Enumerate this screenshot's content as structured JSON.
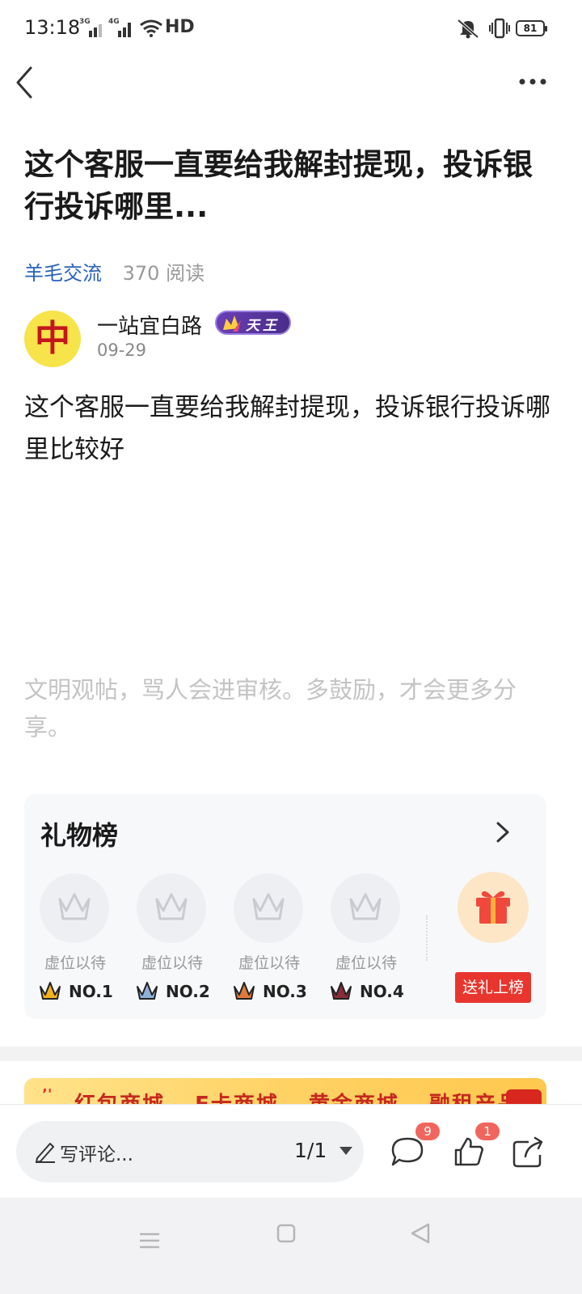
{
  "status_bar": {
    "time": "13:18",
    "signal_1_label": "3G",
    "signal_2_label": "4G",
    "network_label": "HD",
    "battery_level": "81",
    "icons": [
      "signal-icon",
      "wifi-icon",
      "mute-icon",
      "vibrate-icon",
      "battery-icon"
    ]
  },
  "nav": {
    "back_icon": "chevron-left-icon",
    "more_icon": "more-dots-icon"
  },
  "post": {
    "title": "这个客服一直要给我解封提现，投诉银行投诉哪里...",
    "category": "羊毛交流",
    "reads": "370 阅读",
    "author": {
      "name": "一站宜白路",
      "avatar_glyph": "中",
      "level_badge": "天王",
      "date": "09-29"
    },
    "content": "这个客服一直要给我解封提现，投诉银行投诉哪里比较好"
  },
  "notice": "文明观帖，骂人会进审核。多鼓励，才会更多分享。",
  "gift_board": {
    "title": "礼物榜",
    "slots": [
      {
        "label": "虚位以待",
        "rank": "NO.1",
        "crown_color": "#f2b21c"
      },
      {
        "label": "虚位以待",
        "rank": "NO.2",
        "crown_color": "#8fb0d6"
      },
      {
        "label": "虚位以待",
        "rank": "NO.3",
        "crown_color": "#e07a3c"
      },
      {
        "label": "虚位以待",
        "rank": "NO.4",
        "crown_color": "#8a2c3a"
      }
    ],
    "send_button": "送礼上榜"
  },
  "mall_banner": {
    "items": [
      "红包商城",
      "E卡商城",
      "黄金商城",
      "融租产品"
    ]
  },
  "bottom_bar": {
    "comment_placeholder": "写评论...",
    "page_indicator": "1/1",
    "comment_count": "9",
    "like_count": "1"
  },
  "colors": {
    "link_blue": "#2a62b8",
    "accent_red": "#e8362e",
    "badge_red": "#f0665e"
  }
}
